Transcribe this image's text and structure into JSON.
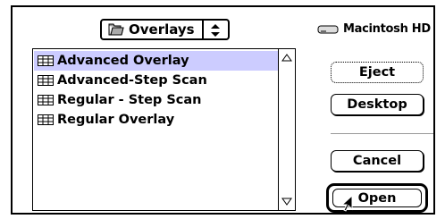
{
  "folder_popup": {
    "label": "Overlays"
  },
  "disk": {
    "label": "Macintosh HD"
  },
  "files": [
    {
      "name": "Advanced Overlay",
      "selected": true
    },
    {
      "name": "Advanced-Step Scan",
      "selected": false
    },
    {
      "name": "Regular - Step Scan",
      "selected": false
    },
    {
      "name": "Regular Overlay",
      "selected": false
    }
  ],
  "buttons": {
    "eject": "Eject",
    "desktop": "Desktop",
    "cancel": "Cancel",
    "open": "Open"
  },
  "colors": {
    "selection": "#ccccff",
    "border": "#000000",
    "background": "#ffffff"
  },
  "icons": {
    "folder": "folder-icon",
    "disk": "hard-disk-icon",
    "file": "document-icon",
    "popup_arrows": "up-down-arrows-icon",
    "scroll_up": "scroll-up-arrow-icon",
    "scroll_down": "scroll-down-arrow-icon",
    "cursor": "arrow-cursor-icon"
  }
}
